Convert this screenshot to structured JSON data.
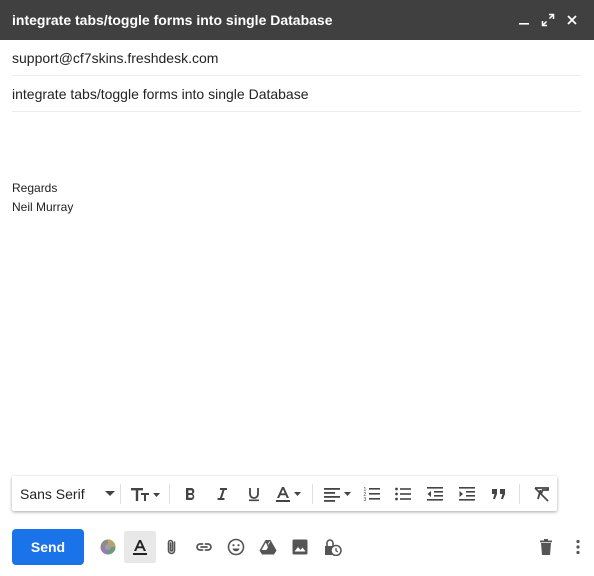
{
  "window": {
    "title": "integrate tabs/toggle forms into single Database"
  },
  "fields": {
    "to": "support@cf7skins.freshdesk.com",
    "subject": "integrate tabs/toggle forms into single Database"
  },
  "body": {
    "signature_line1": "Regards",
    "signature_line2": "Neil Murray"
  },
  "formatting": {
    "font": "Sans Serif"
  },
  "actions": {
    "send_label": "Send"
  },
  "colors": {
    "titlebar": "#404040",
    "send": "#1a73e8"
  }
}
